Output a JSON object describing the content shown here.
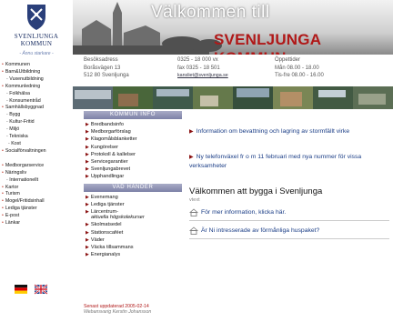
{
  "sidebar": {
    "kommun_line1": "SVENLJUNGA",
    "kommun_line2": "KOMMUN",
    "tagline": "- Ännu starkare -",
    "nav": [
      {
        "label": "Kommunen",
        "level": "main"
      },
      {
        "label": "Barn&Utbildning",
        "level": "main"
      },
      {
        "label": "Vuxenutbildning",
        "level": "sub"
      },
      {
        "label": "Kommunledning",
        "level": "main"
      },
      {
        "label": "Folkhälsa",
        "level": "sub"
      },
      {
        "label": "Konsumentråd",
        "level": "sub"
      },
      {
        "label": "Samhällsbyggnad",
        "level": "main"
      },
      {
        "label": "Bygg",
        "level": "sub"
      },
      {
        "label": "Kultur-Fritid",
        "level": "sub"
      },
      {
        "label": "Miljö",
        "level": "sub"
      },
      {
        "label": "Tekniska",
        "level": "sub"
      },
      {
        "label": "Kost",
        "level": "sub2"
      },
      {
        "label": "Socialförvaltningen",
        "level": "main"
      },
      {
        "label": "",
        "level": "gap"
      },
      {
        "label": "Medborgarservice",
        "level": "main"
      },
      {
        "label": "Näringsliv",
        "level": "main"
      },
      {
        "label": "Internationellt",
        "level": "sub"
      },
      {
        "label": "Kartor",
        "level": "main"
      },
      {
        "label": "Turism",
        "level": "main"
      },
      {
        "label": "Mogel/Fritidsinhall",
        "level": "main"
      },
      {
        "label": "Lediga tjänster",
        "level": "main"
      },
      {
        "label": "E-post",
        "level": "main"
      },
      {
        "label": "Länkar",
        "level": "main"
      }
    ]
  },
  "banner": {
    "welcome": "Välkommen till",
    "brand": "SVENLJUNGA KOMMUN"
  },
  "contact": {
    "col1": [
      "Besöksadress",
      "Boråsvägen 13",
      "512 80 Svenljunga"
    ],
    "col2": [
      "0325 - 18 000 vx",
      "fax 0325 - 18 501",
      "kansliet@svenljunga.se"
    ],
    "col3": [
      "Öppettider",
      "Mån 08.00 - 18.00",
      "Tis-fre 08.00 - 16.00"
    ]
  },
  "menu": {
    "head1": "KOMMUN INFO",
    "items1": [
      "Bredbandsinfo",
      "Medborgarförslag",
      "Klagomålsblanketter",
      "Kungörelser",
      "Protokoll & kallelser",
      "Servicegarantier",
      "Svenljungabrevet",
      "Upphandlingar"
    ],
    "head2": "VAD HÄNDER",
    "items2": [
      {
        "label": "Evenemang"
      },
      {
        "label": "Lediga tjänster"
      },
      {
        "label": "Lärcentrum-",
        "sub": "aktuella högskolekurser"
      },
      {
        "label": "Skolmatsedel"
      },
      {
        "label": "Stationscaféet"
      },
      {
        "label": "Väder"
      },
      {
        "label": "Väcka tillsammans"
      },
      {
        "label": "Energianalys"
      }
    ],
    "updated_label": "Senast uppdaterad 2005-02-14",
    "webmaster": "Webansvarig Kerstin Johansson"
  },
  "content": {
    "news1": "Information om bevattning och lagring av stormfällt virke",
    "news2": "Ny telefonväxel fr o m 11 februari med nya nummer för vissa verksamheter",
    "build_heading": "Välkommen att bygga i Svenljunga",
    "build_sub": "vtext",
    "link1": "För mer information, klicka här.",
    "link2": "Är Ni intresserade av förmånliga huspaket?"
  },
  "colors": {
    "brand_red": "#b01818",
    "link_blue": "#1a3d86",
    "menu_head": "#8c90b3"
  }
}
